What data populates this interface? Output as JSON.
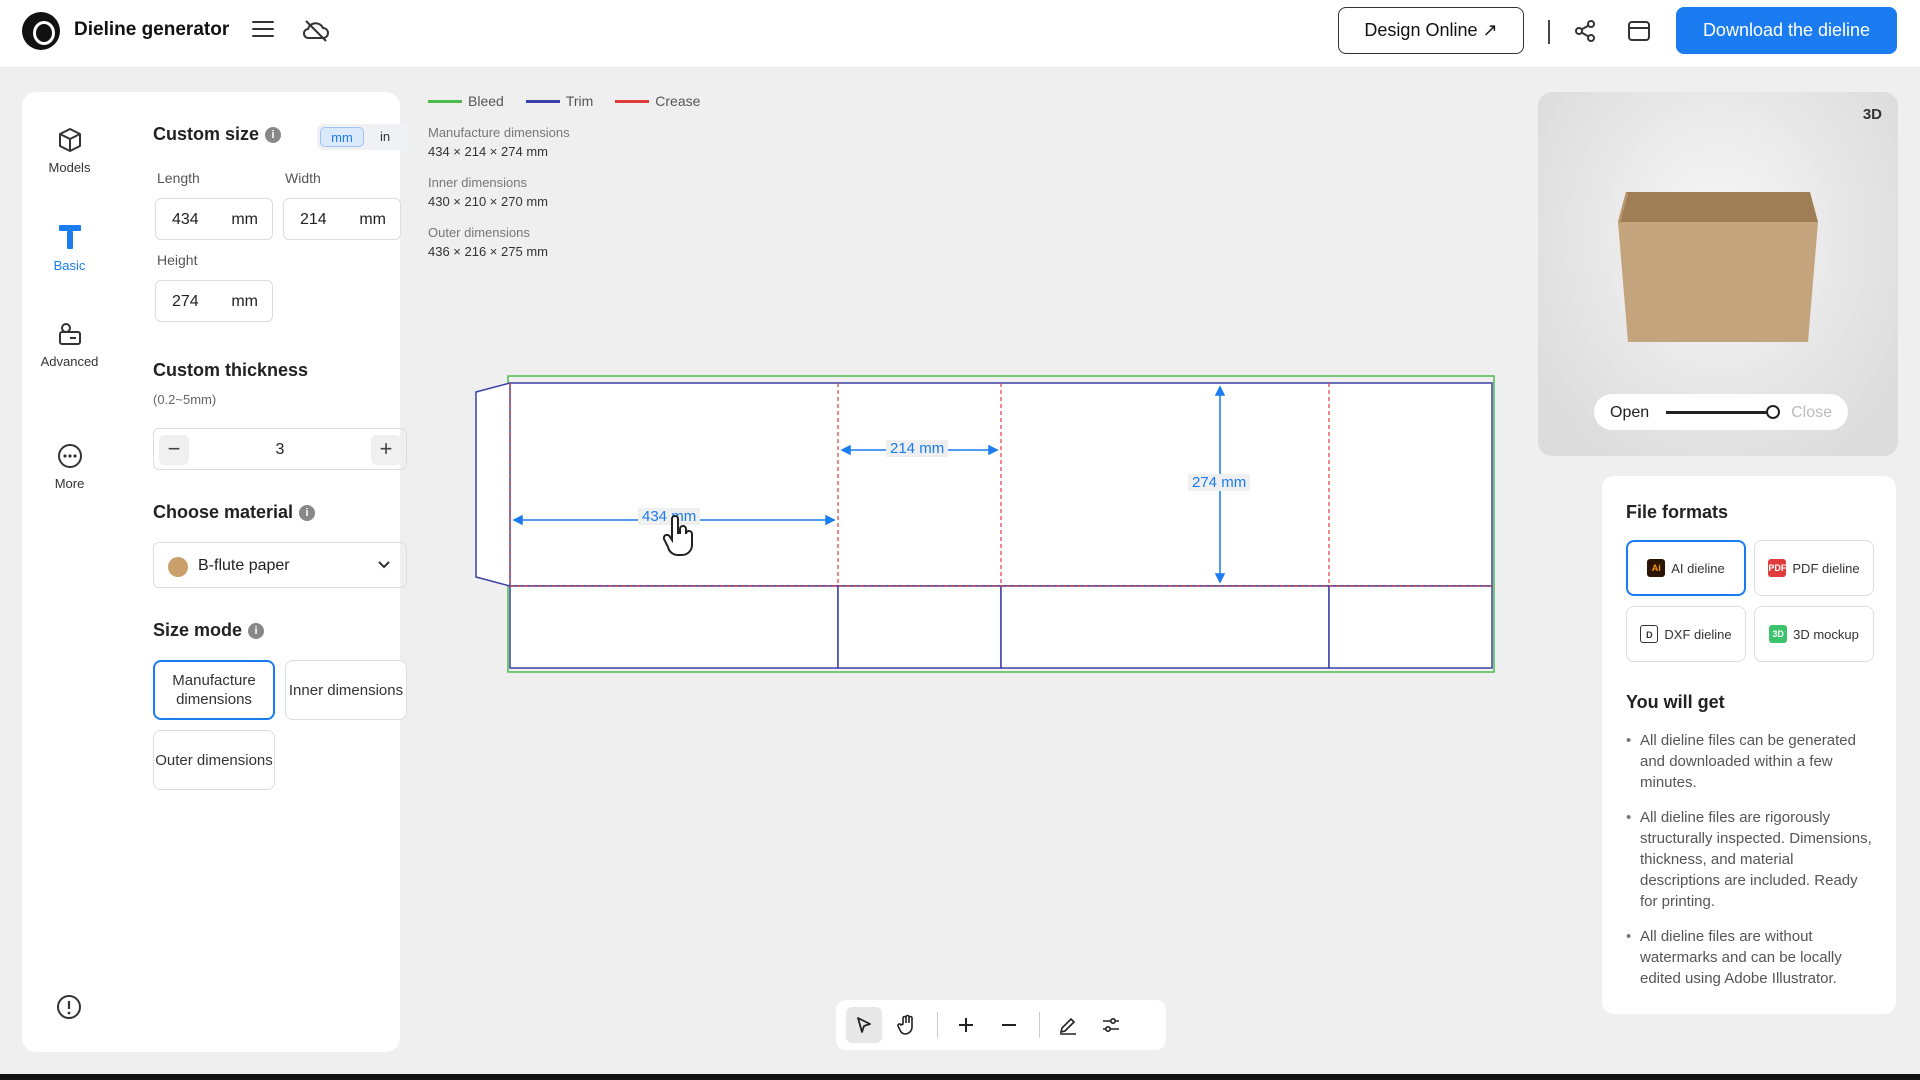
{
  "header": {
    "app_title": "Dieline generator",
    "design_online_label": "Design Online ↗",
    "download_label": "Download the dieline"
  },
  "nav": {
    "items": [
      {
        "label": "Models",
        "icon": "cube-icon"
      },
      {
        "label": "Basic",
        "icon": "basic-icon",
        "active": true
      },
      {
        "label": "Advanced",
        "icon": "advanced-icon"
      },
      {
        "label": "More",
        "icon": "more-icon"
      }
    ]
  },
  "settings": {
    "custom_size_title": "Custom size",
    "units": [
      "mm",
      "in"
    ],
    "selected_unit": "mm",
    "length_label": "Length",
    "length_value": "434",
    "width_label": "Width",
    "width_value": "214",
    "height_label": "Height",
    "height_value": "274",
    "unit": "mm",
    "thickness_title": "Custom thickness",
    "thickness_range": "(0.2~5mm)",
    "thickness_value": "3",
    "material_title": "Choose material",
    "material_value": "B-flute paper",
    "material_color": "#c9a06b",
    "size_mode_title": "Size mode",
    "size_modes": [
      "Manufacture dimensions",
      "Inner dimensions",
      "Outer dimensions"
    ],
    "selected_size_mode": "Manufacture dimensions"
  },
  "legend": [
    {
      "label": "Bleed",
      "color": "#4cbb4c"
    },
    {
      "label": "Trim",
      "color": "#3b3fa8"
    },
    {
      "label": "Crease",
      "color": "#e03c3c"
    }
  ],
  "dimensions": {
    "manufacture_label": "Manufacture dimensions",
    "manufacture_value": "434 × 214 × 274 mm",
    "inner_label": "Inner dimensions",
    "inner_value": "430 × 210 × 270 mm",
    "outer_label": "Outer dimensions",
    "outer_value": "436 × 216 × 275 mm"
  },
  "dieline_labels": {
    "length": "434 mm",
    "width": "214 mm",
    "height": "274 mm"
  },
  "preview": {
    "badge": "3D",
    "open_label": "Open",
    "close_label": "Close",
    "open_level": 1.0
  },
  "files": {
    "title": "File formats",
    "formats": [
      {
        "label": "AI dieline",
        "icon_text": "Ai",
        "color": "#2b1500",
        "selected": true
      },
      {
        "label": "PDF dieline",
        "icon_text": "PDF",
        "color": "#e03c3c"
      },
      {
        "label": "DXF dieline",
        "icon_text": "D",
        "color": "#333333"
      },
      {
        "label": "3D mockup",
        "icon_text": "3D",
        "color": "#3cc46a"
      }
    ],
    "you_will_get_title": "You will get",
    "bullets": [
      "All dieline files can be generated and downloaded within a few minutes.",
      "All dieline files are rigorously structurally inspected. Dimensions, thickness, and material descriptions are included. Ready for printing.",
      "All dieline files are without watermarks and can be locally edited using Adobe Illustrator."
    ]
  },
  "colors": {
    "accent": "#1a7cf0"
  }
}
